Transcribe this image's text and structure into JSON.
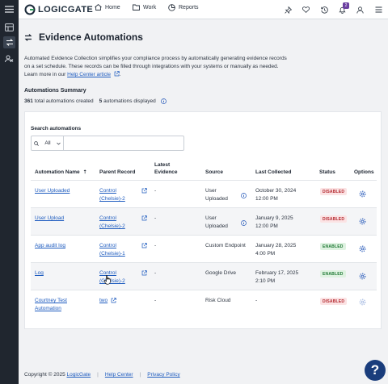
{
  "brand": {
    "name": "LOGICGATE"
  },
  "topnav": {
    "home": "Home",
    "work": "Work",
    "reports": "Reports",
    "notification_count": "2"
  },
  "page": {
    "title": "Evidence Automations",
    "description_1": "Automated Evidence Collection simplifies your compliance process by automatically generating evidence records on a set schedule. These records can be filled through integrations with your systems or manually as needed. Learn more in our ",
    "help_link": "Help Center article",
    "description_2": "."
  },
  "summary": {
    "title": "Automations Summary",
    "total_count": "361",
    "total_label": "total automations created",
    "displayed_count": "5",
    "displayed_label": "automations displayed"
  },
  "search": {
    "label": "Search automations",
    "scope": "All",
    "value": ""
  },
  "table": {
    "columns": {
      "name": "Automation Name",
      "parent": "Parent Record",
      "latest_1": "Latest",
      "latest_2": "Evidence",
      "source": "Source",
      "last_collected": "Last Collected",
      "status": "Status",
      "options": "Options"
    },
    "rows": [
      {
        "name_1": "User Uploaded",
        "name_2": "",
        "parent_1": "Control",
        "parent_2": "(Chelsie)-2",
        "latest": "-",
        "source_1": "User",
        "source_2": "Uploaded",
        "date_1": "October 30, 2024",
        "date_2": "12:00 PM",
        "status": "DISABLED"
      },
      {
        "name_1": "User Upload",
        "name_2": "",
        "parent_1": "Control",
        "parent_2": "(Chelsie)-2",
        "latest": "-",
        "source_1": "User",
        "source_2": "Uploaded",
        "date_1": "January 9, 2025",
        "date_2": "12:00 PM",
        "status": "DISABLED"
      },
      {
        "name_1": "App audit log",
        "name_2": "",
        "parent_1": "Control",
        "parent_2": "(Chelsie)-1",
        "latest": "-",
        "source_1": "Custom Endpoint",
        "source_2": "",
        "date_1": "January 28, 2025",
        "date_2": "4:00 PM",
        "status": "ENABLED"
      },
      {
        "name_1": "Log",
        "name_2": "",
        "parent_1": "Control",
        "parent_2": "(Chelsie)-2",
        "latest": "-",
        "source_1": "Google Drive",
        "source_2": "",
        "date_1": "February 17, 2025",
        "date_2": "2:10 PM",
        "status": "ENABLED"
      },
      {
        "name_1": "Courtney Test",
        "name_2": "Automation",
        "parent_1": "two",
        "parent_2": "",
        "latest": "-",
        "source_1": "Risk Cloud",
        "source_2": "",
        "date_1": "-",
        "date_2": "",
        "status": "DISABLED"
      }
    ]
  },
  "footer": {
    "copyright": "Copyright © 2025",
    "company": "LogicGate",
    "help_center": "Help Center",
    "privacy": "Privacy Policy"
  },
  "help_button": "?",
  "colors": {
    "rail": "#20262f",
    "link": "#1d5bbf",
    "accent": "#2457b8",
    "help": "#1a3d7c"
  }
}
